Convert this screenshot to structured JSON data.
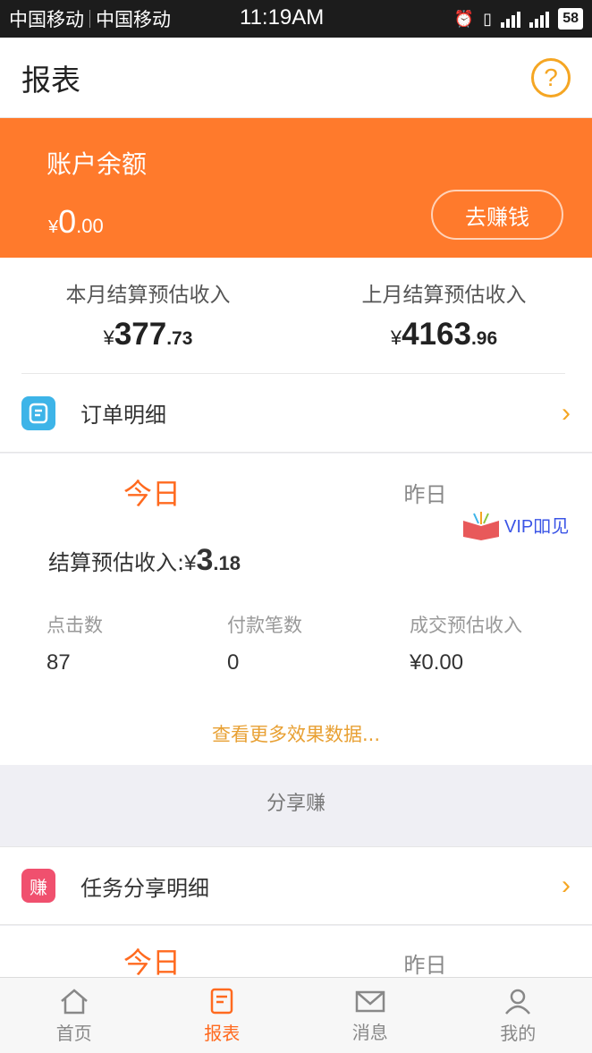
{
  "status_bar": {
    "carrier1": "中国移动",
    "carrier2": "中国移动",
    "time": "11:19AM",
    "battery": "58"
  },
  "header": {
    "title": "报表",
    "help_glyph": "?"
  },
  "balance": {
    "label": "账户余额",
    "currency": "¥",
    "integer": "0",
    "decimal": ".00",
    "earn_button": "去赚钱"
  },
  "income": {
    "this_month": {
      "label": "本月结算预估收入",
      "currency": "¥",
      "integer": "377",
      "decimal": ".73"
    },
    "last_month": {
      "label": "上月结算预估收入",
      "currency": "¥",
      "integer": "4163",
      "decimal": ".96"
    }
  },
  "order_row": {
    "label": "订单明细",
    "icon": "document-icon"
  },
  "stats": {
    "tab_today": "今日",
    "tab_yesterday": "昨日",
    "estimate_label": "结算预估收入:",
    "estimate_currency": "¥",
    "estimate_integer": "3",
    "estimate_decimal": ".18",
    "metrics": [
      {
        "label": "点击数",
        "value": "87"
      },
      {
        "label": "付款笔数",
        "value": "0"
      },
      {
        "label": "成交预估收入",
        "value": "¥0.00"
      }
    ],
    "more_link": "查看更多效果数据..."
  },
  "watermark": {
    "text": "VIP吅见"
  },
  "share": {
    "section_title": "分享赚",
    "row_label": "任务分享明细",
    "row_icon_text": "赚",
    "tab_today": "今日",
    "tab_yesterday": "昨日"
  },
  "tabbar": {
    "items": [
      {
        "label": "首页",
        "icon": "home-icon"
      },
      {
        "label": "报表",
        "icon": "report-icon"
      },
      {
        "label": "消息",
        "icon": "mail-icon"
      },
      {
        "label": "我的",
        "icon": "user-icon"
      }
    ]
  },
  "colors": {
    "accent": "#ff7a2c",
    "link": "#e8a033",
    "order_icon": "#3db4e8",
    "share_icon": "#f0506e"
  }
}
